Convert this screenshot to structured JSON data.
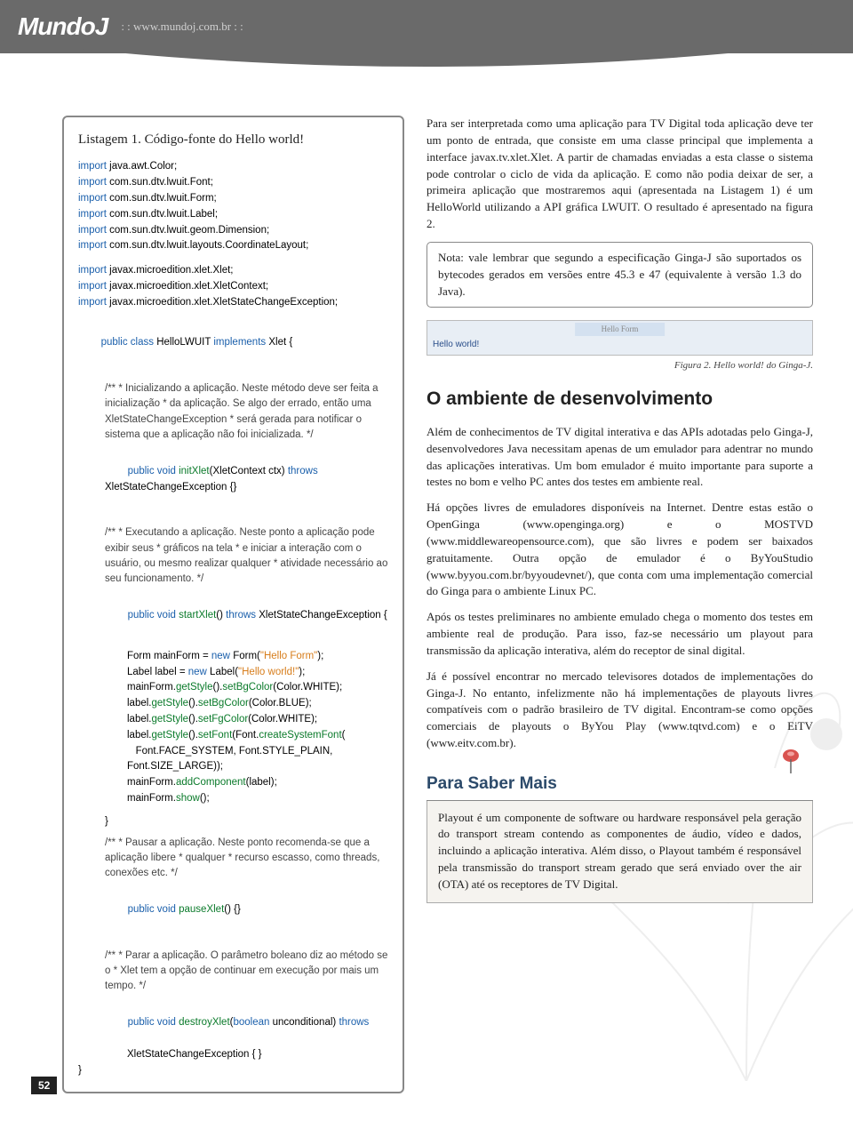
{
  "header": {
    "logo": "MundoJ",
    "breadcrumb": ": : www.mundoj.com.br : :"
  },
  "pagenum": "52",
  "listing": {
    "title": "Listagem 1. Código-fonte do Hello world!",
    "imports_group1": [
      "import java.awt.Color;",
      "import com.sun.dtv.lwuit.Font;",
      "import com.sun.dtv.lwuit.Form;",
      "import com.sun.dtv.lwuit.Label;",
      "import com.sun.dtv.lwuit.geom.Dimension;",
      "import com.sun.dtv.lwuit.layouts.CoordinateLayout;"
    ],
    "imports_group2": [
      "import javax.microedition.xlet.Xlet;",
      "import javax.microedition.xlet.XletContext;",
      "import javax.microedition.xlet.XletStateChangeException;"
    ],
    "class_decl": {
      "prefix": "public class",
      "name": "HelloLWUIT",
      "mid": "implements",
      "iface": "Xlet {"
    },
    "doc1": "/**\n * Inicializando a aplicação. Neste método deve ser feita a inicialização\n * da aplicação. Se algo der errado, então uma XletStateChangeException\n * será gerada para notificar o sistema que a aplicação não foi inicializada.\n */",
    "method1": {
      "sig_pre": "public void",
      "name": "initXlet",
      "params": "(XletContext ctx)",
      "throws": "throws",
      "exc": "XletStateChangeException {}"
    },
    "doc2": "/**\n * Executando a aplicação. Neste ponto a aplicação pode exibir seus\n * gráficos na tela\n * e iniciar a interação com o usuário, ou mesmo realizar qualquer\n * atividade necessário ao seu funcionamento.\n */",
    "method2": {
      "sig_pre": "public void",
      "name": "startXlet",
      "params": "()",
      "throws": "throws",
      "exc": "XletStateChangeException {"
    },
    "body_lines": [
      {
        "l": "Form mainForm = ",
        "kw": "new",
        "cls": " Form(",
        "str": "\"Hello Form\"",
        "end": ");"
      },
      {
        "l": "Label label = ",
        "kw": "new",
        "cls": " Label(",
        "str": "\"Hello world!\"",
        "end": ");"
      },
      {
        "l": "mainForm.",
        "m": "getStyle",
        "l2": "().",
        "m2": "setBgColor",
        "l3": "(Color.WHITE);"
      },
      {
        "l": "label.",
        "m": "getStyle",
        "l2": "().",
        "m2": "setBgColor",
        "l3": "(Color.BLUE);"
      },
      {
        "l": "label.",
        "m": "getStyle",
        "l2": "().",
        "m2": "setFgColor",
        "l3": "(Color.WHITE);"
      },
      {
        "l": "label.",
        "m": "getStyle",
        "l2": "().",
        "m2": "setFont",
        "l3": "(Font.",
        "m3": "createSystemFont",
        "l4": "("
      },
      {
        "l": "   Font.FACE_SYSTEM, Font.STYLE_PLAIN, Font.SIZE_LARGE));"
      },
      {
        "l": "mainForm.",
        "m": "addComponent",
        "l2": "(label);"
      },
      {
        "l": "mainForm.",
        "m": "show",
        "l2": "();"
      }
    ],
    "close_brace": "}",
    "doc3": "/**\n * Pausar a aplicação. Neste ponto recomenda-se que a aplicação libere\n * qualquer\n * recurso escasso, como threads, conexões etc.\n */",
    "method3": {
      "sig_pre": "public void",
      "name": "pauseXlet",
      "params": "() {}"
    },
    "doc4": "/**\n * Parar a aplicação. O parâmetro boleano diz ao método se o\n * Xlet tem a opção de continuar em execução por mais um tempo.\n */",
    "method4": {
      "sig_pre": "public void",
      "name": "destroyXlet",
      "params": "(",
      "ptype": "boolean",
      "pname": " unconditional)",
      "throws": "throws",
      "exc": "XletStateChangeException { }"
    },
    "final_brace": "}"
  },
  "right": {
    "p1": "Para ser interpretada como uma aplicação para TV Digital toda aplicação deve ter um ponto de entrada, que consiste em uma classe principal que implementa a interface javax.tv.xlet.Xlet. A partir de chamadas enviadas a esta classe o sistema pode controlar o ciclo de vida da aplicação. E como não podia deixar de ser, a primeira aplicação que mostraremos aqui (apresentada na Listagem 1) é um HelloWorld utilizando a API gráfica LWUIT. O resultado é apresentado na figura 2.",
    "note": "Nota: vale lembrar que segundo a especificação Ginga-J são suportados os bytecodes gerados em versões entre 45.3 e 47 (equivalente à versão 1.3 do Java).",
    "fig_bar_label": "Hello Form",
    "fig_text": "Hello world!",
    "fig_caption": "Figura 2. Hello world! do Ginga-J.",
    "h2a": "O ambiente de desenvolvimento",
    "p2": "Além de conhecimentos de TV digital interativa e das APIs adotadas pelo Ginga-J, desenvolvedores Java necessitam apenas de um emulador para adentrar no mundo das aplicações interativas. Um bom emulador é muito importante para suporte a testes no bom e velho PC antes dos testes em ambiente real.",
    "p3": "Há opções livres de emuladores disponíveis na Internet. Dentre estas estão o OpenGinga (www.openginga.org) e o MOSTVD (www.middlewareopensource.com), que são livres e podem ser baixados gratuitamente. Outra opção de emulador é o ByYouStudio (www.byyou.com.br/byyoudevnet/), que conta com uma implementação comercial do Ginga para o ambiente Linux PC.",
    "p4": "Após os testes preliminares no ambiente emulado chega o momento dos testes em ambiente real de produção. Para isso, faz-se necessário um playout para transmissão da aplicação interativa, além do receptor de sinal digital.",
    "p5": "Já é possível encontrar no mercado televisores dotados de implementações do Ginga-J. No entanto, infelizmente não há implementações de playouts livres compatíveis com o padrão brasileiro de TV digital. Encontram-se como opções comerciais de playouts o ByYou Play (www.tqtvd.com) e o EiTV (www.eitv.com.br).",
    "callout_title": "Para Saber Mais",
    "callout_body": "Playout é um componente de software ou hardware responsável pela geração do transport stream contendo as componentes de áudio, vídeo e dados, incluindo a aplicação interativa. Além disso, o Playout também é responsável pela transmissão do transport stream gerado que será enviado over the air (OTA) até os receptores de TV Digital."
  }
}
